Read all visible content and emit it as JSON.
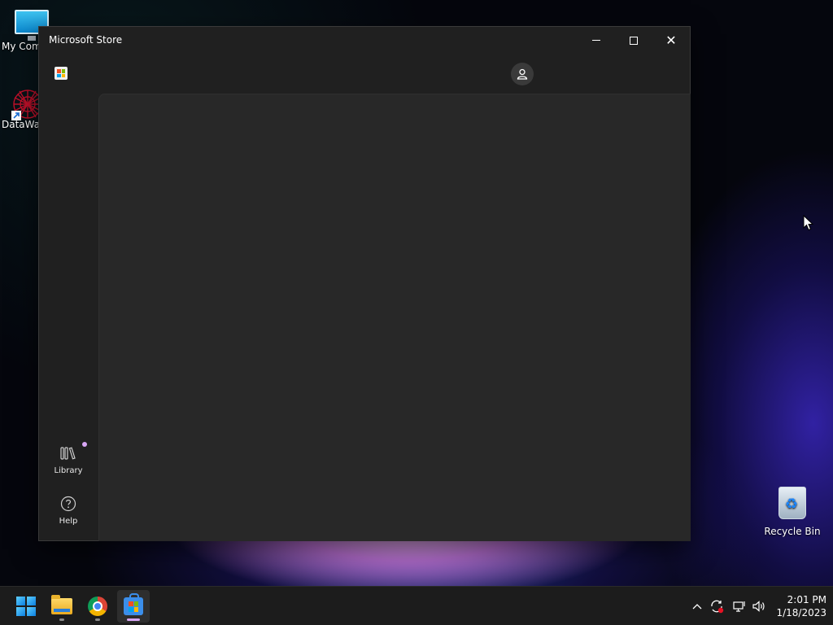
{
  "desktop": {
    "icons": [
      {
        "label": "My Computer",
        "icon": "monitor-icon"
      },
      {
        "label": "DataWagon",
        "icon": "datawagon-icon"
      },
      {
        "label": "Recycle Bin",
        "icon": "recycle-bin-icon"
      }
    ]
  },
  "window": {
    "title": "Microsoft Store",
    "buttons": {
      "minimize": "minimize-icon",
      "maximize": "maximize-icon",
      "close": "close-icon"
    }
  },
  "store": {
    "logo_icon": "store-logo-icon",
    "account_icon": "account-icon",
    "nav": [
      {
        "label": "Library",
        "icon": "library-icon",
        "badge": true
      },
      {
        "label": "Help",
        "icon": "help-icon"
      }
    ]
  },
  "taskbar": {
    "apps": [
      {
        "name": "Start",
        "icon": "windows-start-icon"
      },
      {
        "name": "File Explorer",
        "icon": "folder-icon"
      },
      {
        "name": "Google Chrome",
        "icon": "chrome-icon"
      },
      {
        "name": "Microsoft Store",
        "icon": "store-bag-icon",
        "active": true
      }
    ],
    "tray": [
      "chevron-up-icon",
      "sync-icon",
      "network-icon",
      "volume-icon"
    ],
    "time": "2:01 PM",
    "date": "1/18/2023"
  },
  "colors": {
    "window_bg": "#202020",
    "content_bg": "#282828",
    "taskbar_bg": "#1c1c1c",
    "accent": "#d8a7f5",
    "store_blue": "#3b8eea"
  }
}
